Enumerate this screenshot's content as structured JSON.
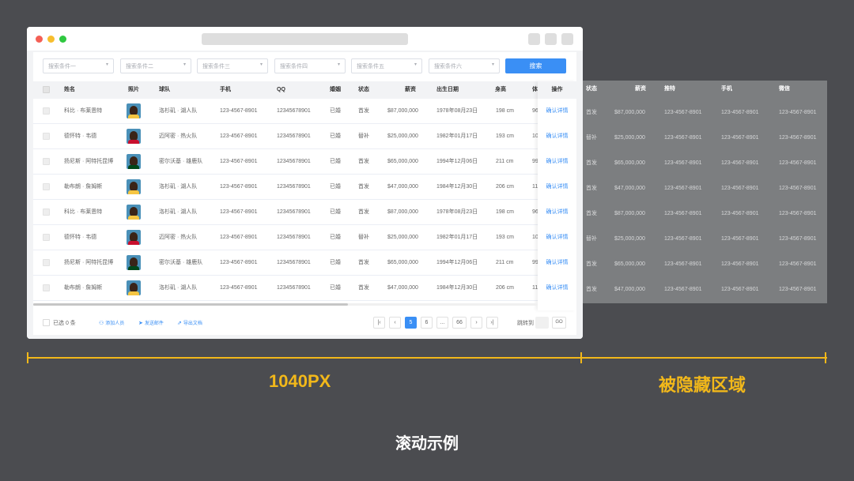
{
  "filters": [
    "搜索条件一",
    "搜索条件二",
    "搜索条件三",
    "搜索条件四",
    "搜索条件五",
    "搜索条件六"
  ],
  "search_label": "搜索",
  "columns": {
    "name": "姓名",
    "photo": "照片",
    "team": "球队",
    "phone": "手机",
    "qq": "QQ",
    "marital": "婚姻",
    "status": "状态",
    "salary": "薪资",
    "birth": "出生日期",
    "height": "身高",
    "weight": "体",
    "action": "操作"
  },
  "rows": [
    {
      "name": "科比 · 布莱恩特",
      "team": "洛杉矶 · 湖人队",
      "phone": "123-4567-8901",
      "qq": "12345678901",
      "marital": "已婚",
      "status": "首发",
      "salary": "$87,000,000",
      "birth": "1978年08月23日",
      "height": "198 cm",
      "weight": "96",
      "action": "确认详情"
    },
    {
      "name": "德怀特 · 韦德",
      "team": "迈阿密 · 热火队",
      "phone": "123-4567-8901",
      "qq": "12345678901",
      "marital": "已婚",
      "status": "替补",
      "salary": "$25,000,000",
      "birth": "1982年01月17日",
      "height": "193 cm",
      "weight": "10",
      "action": "确认详情"
    },
    {
      "name": "扬尼斯 · 阿特托昆博",
      "team": "密尔沃基 · 雄鹿队",
      "phone": "123-4567-8901",
      "qq": "12345678901",
      "marital": "已婚",
      "status": "首发",
      "salary": "$65,000,000",
      "birth": "1994年12月06日",
      "height": "211 cm",
      "weight": "99",
      "action": "确认详情"
    },
    {
      "name": "勒布朗 · 詹姆斯",
      "team": "洛杉矶 · 湖人队",
      "phone": "123-4567-8901",
      "qq": "12345678901",
      "marital": "已婚",
      "status": "首发",
      "salary": "$47,000,000",
      "birth": "1984年12月30日",
      "height": "206 cm",
      "weight": "11",
      "action": "确认详情"
    },
    {
      "name": "科比 · 布莱恩特",
      "team": "洛杉矶 · 湖人队",
      "phone": "123-4567-8901",
      "qq": "12345678901",
      "marital": "已婚",
      "status": "首发",
      "salary": "$87,000,000",
      "birth": "1978年08月23日",
      "height": "198 cm",
      "weight": "96",
      "action": "确认详情"
    },
    {
      "name": "德怀特 · 韦德",
      "team": "迈阿密 · 热火队",
      "phone": "123-4567-8901",
      "qq": "12345678901",
      "marital": "已婚",
      "status": "替补",
      "salary": "$25,000,000",
      "birth": "1982年01月17日",
      "height": "193 cm",
      "weight": "10",
      "action": "确认详情"
    },
    {
      "name": "扬尼斯 · 阿特托昆博",
      "team": "密尔沃基 · 雄鹿队",
      "phone": "123-4567-8901",
      "qq": "12345678901",
      "marital": "已婚",
      "status": "首发",
      "salary": "$65,000,000",
      "birth": "1994年12月06日",
      "height": "211 cm",
      "weight": "99",
      "action": "确认详情"
    },
    {
      "name": "勒布朗 · 詹姆斯",
      "team": "洛杉矶 · 湖人队",
      "phone": "123-4567-8901",
      "qq": "12345678901",
      "marital": "已婚",
      "status": "首发",
      "salary": "$47,000,000",
      "birth": "1984年12月30日",
      "height": "206 cm",
      "weight": "11",
      "action": "确认详情"
    }
  ],
  "footer": {
    "selected": "已选 0 条",
    "add": "添加人员",
    "mail": "发送邮件",
    "export": "导出文档",
    "pages": [
      "5",
      "6",
      "...",
      "66"
    ],
    "active_page": "5",
    "jump_label": "跳转到",
    "go": "GO"
  },
  "hidden_columns": {
    "status": "状态",
    "salary": "薪资",
    "twitter": "推特",
    "phone": "手机",
    "wechat": "微信"
  },
  "hidden_rows": [
    {
      "status": "首发",
      "salary": "$87,000,000",
      "twitter": "123-4567-8901",
      "phone": "123-4567-8901",
      "wechat": "123-4567-8901"
    },
    {
      "status": "替补",
      "salary": "$25,000,000",
      "twitter": "123-4567-8901",
      "phone": "123-4567-8901",
      "wechat": "123-4567-8901"
    },
    {
      "status": "首发",
      "salary": "$65,000,000",
      "twitter": "123-4567-8901",
      "phone": "123-4567-8901",
      "wechat": "123-4567-8901"
    },
    {
      "status": "首发",
      "salary": "$47,000,000",
      "twitter": "123-4567-8901",
      "phone": "123-4567-8901",
      "wechat": "123-4567-8901"
    },
    {
      "status": "首发",
      "salary": "$87,000,000",
      "twitter": "123-4567-8901",
      "phone": "123-4567-8901",
      "wechat": "123-4567-8901"
    },
    {
      "status": "替补",
      "salary": "$25,000,000",
      "twitter": "123-4567-8901",
      "phone": "123-4567-8901",
      "wechat": "123-4567-8901"
    },
    {
      "status": "首发",
      "salary": "$65,000,000",
      "twitter": "123-4567-8901",
      "phone": "123-4567-8901",
      "wechat": "123-4567-8901"
    },
    {
      "status": "首发",
      "salary": "$47,000,000",
      "twitter": "123-4567-8901",
      "phone": "123-4567-8901",
      "wechat": "123-4567-8901"
    }
  ],
  "measure": {
    "visible_label": "1040PX",
    "hidden_label": "被隐藏区域"
  },
  "caption": "滚动示例",
  "colors": {
    "accent": "#3a8ff5",
    "highlight": "#f2b81a",
    "background": "#4b4c50",
    "hidden_area": "#7c7e80"
  }
}
